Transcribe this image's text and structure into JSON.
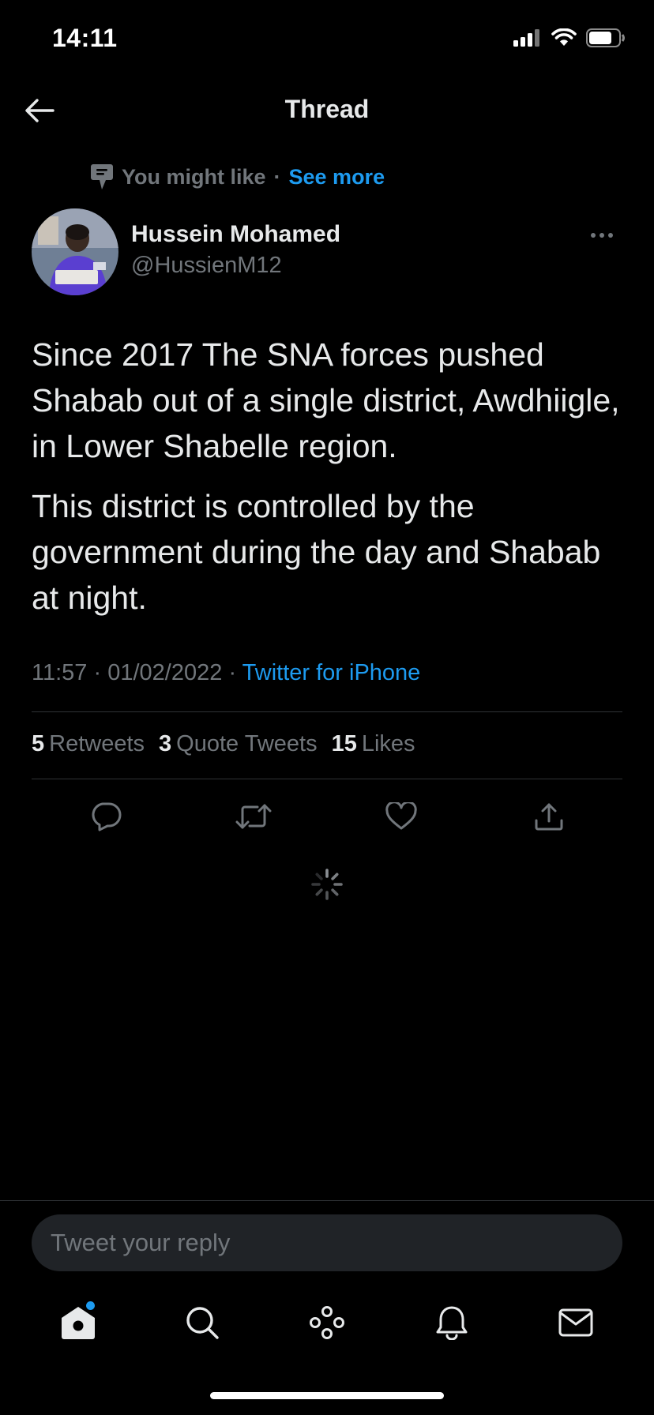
{
  "status_bar": {
    "time": "14:11",
    "icons": [
      "signal-icon",
      "wifi-icon",
      "battery-icon"
    ]
  },
  "header": {
    "title": "Thread",
    "back_icon": "arrow-left-icon"
  },
  "context": {
    "icon": "topic-icon",
    "text": "You might like",
    "separator": "·",
    "link": "See more"
  },
  "author": {
    "name": "Hussein Mohamed",
    "handle": "@HussienM12",
    "more_icon": "more-horizontal-icon"
  },
  "tweet": {
    "paragraphs": [
      "Since 2017 The SNA forces pushed Shabab out of a single district, Awdhiigle, in Lower Shabelle region.",
      "This district is controlled by the government during the day and Shabab at night."
    ],
    "time": "11:57",
    "date": "01/02/2022",
    "separator": "·",
    "source": "Twitter for iPhone"
  },
  "stats": {
    "retweets_count": "5",
    "retweets_label": "Retweets",
    "quotes_count": "3",
    "quotes_label": "Quote Tweets",
    "likes_count": "15",
    "likes_label": "Likes"
  },
  "actions": [
    "reply-icon",
    "retweet-icon",
    "like-icon",
    "share-icon"
  ],
  "reply": {
    "placeholder": "Tweet your reply"
  },
  "tabbar": [
    "home-icon",
    "search-icon",
    "spaces-icon",
    "notifications-icon",
    "messages-icon"
  ],
  "colors": {
    "background": "#000000",
    "text": "#e7e9ea",
    "muted": "#71767b",
    "accent": "#1d9bf0",
    "divider": "#2f3336",
    "input_bg": "#202327"
  }
}
